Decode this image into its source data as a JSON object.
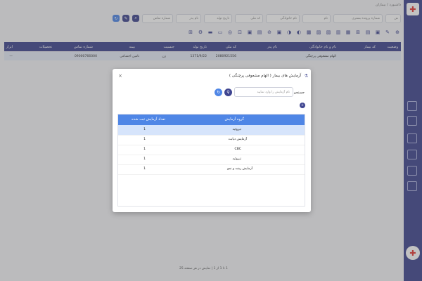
{
  "breadcrumb": "داشبورد / بیماران",
  "filters": {
    "doc_no": "ش",
    "file_no": "شماره پرونده بستری",
    "name": "نام",
    "family": "نام خانوادگی",
    "national_code": "کد ملی",
    "birth_date": "تاریخ تولد",
    "father": "نام پدر",
    "phone": "شماره تماس"
  },
  "table": {
    "headers": [
      "وضعیت",
      "کد بیمار",
      "نام و نام خانوادگی",
      "نام پدر",
      "کد ملی",
      "تاریخ تولد",
      "جنسیت",
      "بیمه",
      "شماره تماس",
      "تحصیلات",
      "ابزار"
    ],
    "row": [
      "",
      "",
      "الهام مشعوفی پرچنگی",
      "",
      "2080921556",
      "1371/9/22",
      "زن",
      "تامین اجتماعی",
      "09000766000",
      "",
      "—"
    ]
  },
  "modal": {
    "title": "آزمایش های بیمار ( الهام مشعوفی پرچنگی )",
    "close": "×",
    "search_label": "جستجو",
    "search_placeholder": "نام آزمایش را وارد نمایید",
    "headers": [
      "گروه آزمایش",
      "تعداد آزمایش ثبت شده"
    ],
    "rows": [
      [
        "تیروئید",
        "1"
      ],
      [
        "آزمایش دیابت",
        "1"
      ],
      [
        "CBC",
        "1"
      ],
      [
        "تیروئید",
        "1"
      ],
      [
        "آزمایش رشد و نمو",
        "1"
      ]
    ]
  },
  "pager": "1 تا 1 از 1 | نمایش در هر صفحه 25"
}
